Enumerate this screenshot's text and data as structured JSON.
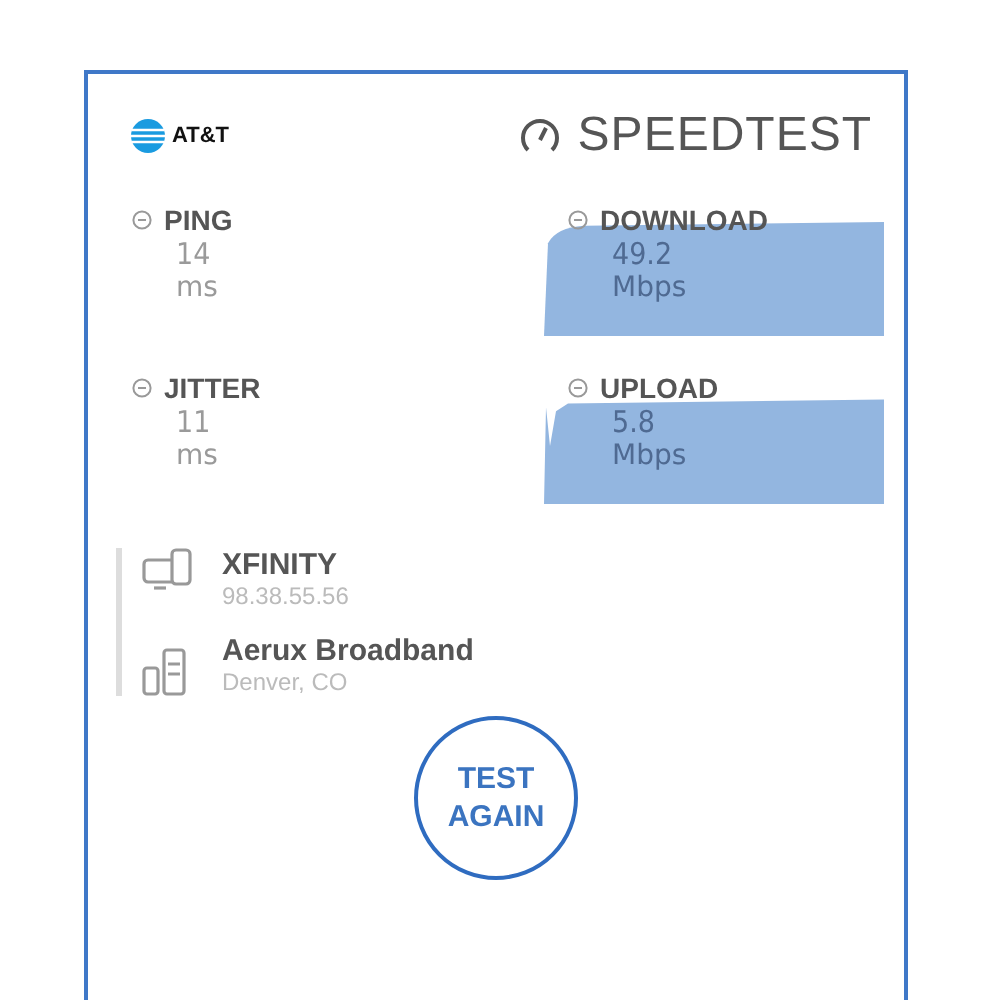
{
  "header": {
    "carrier": "AT&T",
    "brand": "SPEEDTEST"
  },
  "metrics": [
    {
      "kind": "plain",
      "label": "PING",
      "value": "14",
      "unit": "ms"
    },
    {
      "kind": "graph",
      "label": "DOWNLOAD",
      "value": "49.2",
      "unit": "Mbps"
    },
    {
      "kind": "plain",
      "label": "JITTER",
      "value": "11",
      "unit": "ms"
    },
    {
      "kind": "graph",
      "label": "UPLOAD",
      "value": "5.8",
      "unit": "Mbps"
    }
  ],
  "connection": [
    {
      "kind": "client",
      "name": "XFINITY",
      "detail": "98.38.55.56"
    },
    {
      "kind": "server",
      "name": "Aerux Broadband",
      "detail": "Denver, CO"
    }
  ],
  "button": "TEST AGAIN"
}
